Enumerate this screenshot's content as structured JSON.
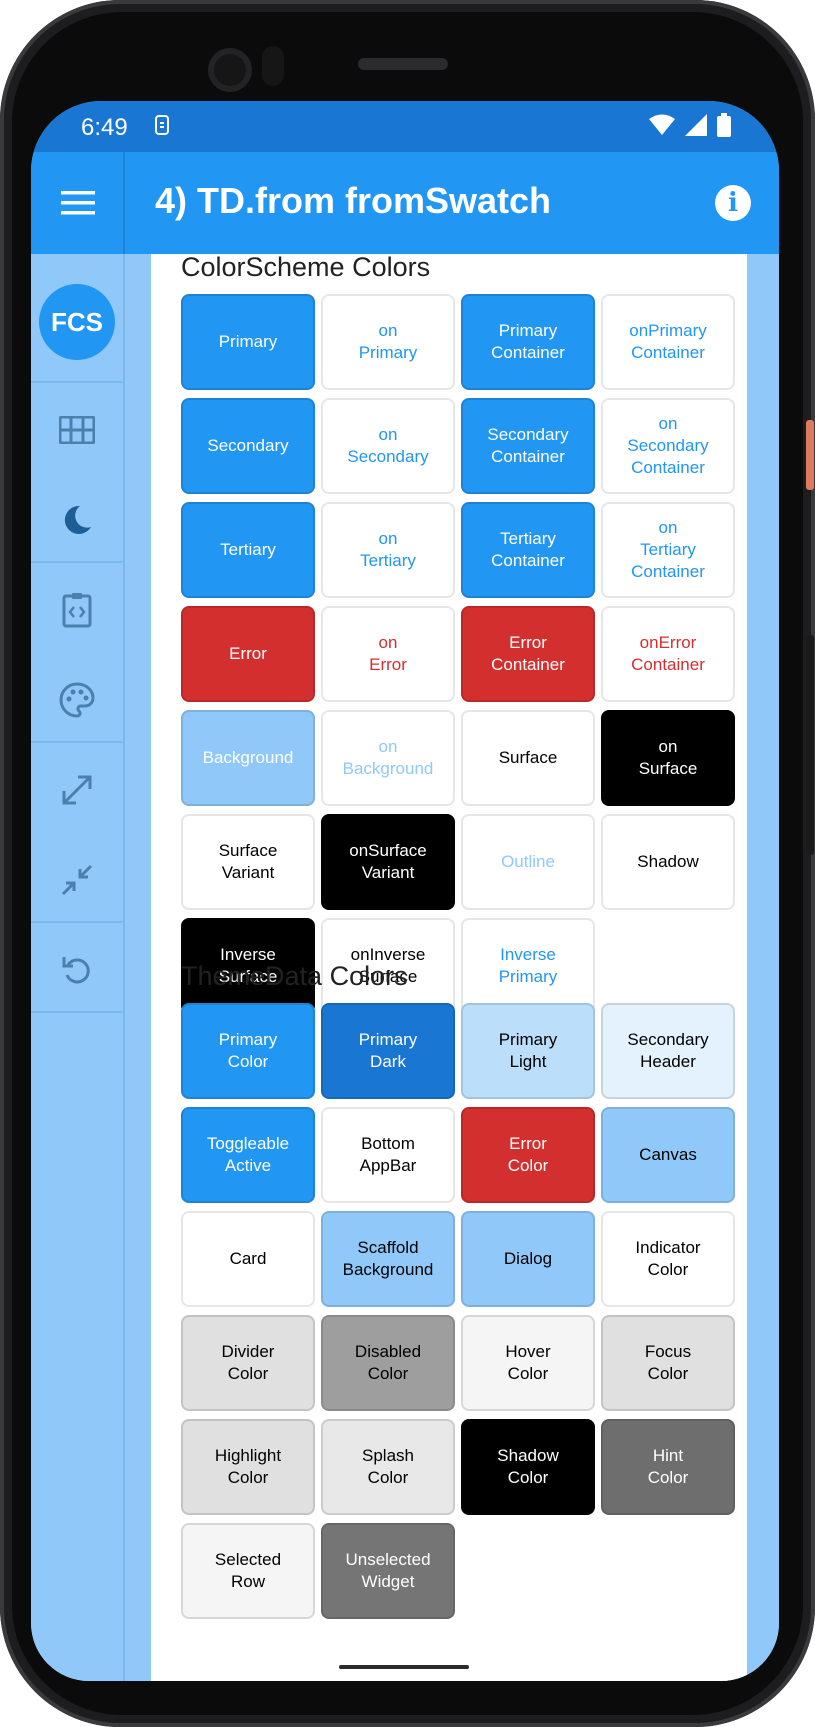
{
  "status_bar": {
    "time": "6:49"
  },
  "app_bar": {
    "title": "4) TD.from fromSwatch",
    "info_label": "i"
  },
  "nav_rail": {
    "badge_label": "FCS"
  },
  "colorscheme_section": {
    "title": "ColorScheme Colors",
    "cells": [
      {
        "label": "Primary",
        "bg": "#2196f3",
        "fg": "#ffffff"
      },
      {
        "label": "on\nPrimary",
        "bg": "#ffffff",
        "fg": "#2196f3"
      },
      {
        "label": "Primary\nContainer",
        "bg": "#2196f3",
        "fg": "#ffffff"
      },
      {
        "label": "onPrimary\nContainer",
        "bg": "#ffffff",
        "fg": "#2196f3"
      },
      {
        "label": "Secondary",
        "bg": "#2196f3",
        "fg": "#ffffff"
      },
      {
        "label": "on\nSecondary",
        "bg": "#ffffff",
        "fg": "#2196f3"
      },
      {
        "label": "Secondary\nContainer",
        "bg": "#2196f3",
        "fg": "#ffffff"
      },
      {
        "label": "on\nSecondary\nContainer",
        "bg": "#ffffff",
        "fg": "#2196f3"
      },
      {
        "label": "Tertiary",
        "bg": "#2196f3",
        "fg": "#ffffff"
      },
      {
        "label": "on\nTertiary",
        "bg": "#ffffff",
        "fg": "#2196f3"
      },
      {
        "label": "Tertiary\nContainer",
        "bg": "#2196f3",
        "fg": "#ffffff"
      },
      {
        "label": "on\nTertiary\nContainer",
        "bg": "#ffffff",
        "fg": "#2196f3"
      },
      {
        "label": "Error",
        "bg": "#d32f2f",
        "fg": "#ffffff"
      },
      {
        "label": "on\nError",
        "bg": "#ffffff",
        "fg": "#d32f2f"
      },
      {
        "label": "Error\nContainer",
        "bg": "#d32f2f",
        "fg": "#ffffff"
      },
      {
        "label": "onError\nContainer",
        "bg": "#ffffff",
        "fg": "#d32f2f"
      },
      {
        "label": "Background",
        "bg": "#90c9f9",
        "fg": "#ffffff"
      },
      {
        "label": "on\nBackground",
        "bg": "#ffffff",
        "fg": "#90c9f9"
      },
      {
        "label": "Surface",
        "bg": "#ffffff",
        "fg": "#000000"
      },
      {
        "label": "on\nSurface",
        "bg": "#000000",
        "fg": "#ffffff"
      },
      {
        "label": "Surface\nVariant",
        "bg": "#ffffff",
        "fg": "#000000"
      },
      {
        "label": "onSurface\nVariant",
        "bg": "#000000",
        "fg": "#ffffff"
      },
      {
        "label": "Outline",
        "bg": "#ffffff",
        "fg": "#90c9f9"
      },
      {
        "label": "Shadow",
        "bg": "#ffffff",
        "fg": "#000000"
      },
      {
        "label": "Inverse\nSurface",
        "bg": "#000000",
        "fg": "#ffffff"
      },
      {
        "label": "onInverse\nSurface",
        "bg": "#ffffff",
        "fg": "#000000"
      },
      {
        "label": "Inverse\nPrimary",
        "bg": "#ffffff",
        "fg": "#2196f3"
      }
    ]
  },
  "themedata_section": {
    "title": "ThemeData Colors",
    "cells": [
      {
        "label": "Primary\nColor",
        "bg": "#2196f3",
        "fg": "#ffffff"
      },
      {
        "label": "Primary\nDark",
        "bg": "#1976d2",
        "fg": "#ffffff"
      },
      {
        "label": "Primary\nLight",
        "bg": "#bbdefb",
        "fg": "#000000"
      },
      {
        "label": "Secondary\nHeader",
        "bg": "#e3f2fd",
        "fg": "#000000"
      },
      {
        "label": "Toggleable\nActive",
        "bg": "#2196f3",
        "fg": "#ffffff"
      },
      {
        "label": "Bottom\nAppBar",
        "bg": "#ffffff",
        "fg": "#000000"
      },
      {
        "label": "Error\nColor",
        "bg": "#d32f2f",
        "fg": "#ffffff"
      },
      {
        "label": "Canvas",
        "bg": "#90c9f9",
        "fg": "#000000"
      },
      {
        "label": "Card",
        "bg": "#ffffff",
        "fg": "#000000"
      },
      {
        "label": "Scaffold\nBackground",
        "bg": "#90c9f9",
        "fg": "#000000"
      },
      {
        "label": "Dialog",
        "bg": "#90c9f9",
        "fg": "#000000"
      },
      {
        "label": "Indicator\nColor",
        "bg": "#ffffff",
        "fg": "#000000"
      },
      {
        "label": "Divider\nColor",
        "bg": "#e0e0e0",
        "fg": "#000000"
      },
      {
        "label": "Disabled\nColor",
        "bg": "#9e9e9e",
        "fg": "#000000"
      },
      {
        "label": "Hover\nColor",
        "bg": "#f5f5f5",
        "fg": "#000000"
      },
      {
        "label": "Focus\nColor",
        "bg": "#e0e0e0",
        "fg": "#000000"
      },
      {
        "label": "Highlight\nColor",
        "bg": "#e0e0e0",
        "fg": "#000000"
      },
      {
        "label": "Splash\nColor",
        "bg": "#e8e8e8",
        "fg": "#000000"
      },
      {
        "label": "Shadow\nColor",
        "bg": "#000000",
        "fg": "#ffffff"
      },
      {
        "label": "Hint\nColor",
        "bg": "#6e6e6e",
        "fg": "#ffffff"
      },
      {
        "label": "Selected\nRow",
        "bg": "#f5f5f5",
        "fg": "#000000"
      },
      {
        "label": "Unselected\nWidget",
        "bg": "#757575",
        "fg": "#ffffff"
      }
    ]
  },
  "colors": {
    "primary": "#2196f3",
    "primary_dark": "#1976d2",
    "background": "#90c9f9"
  }
}
